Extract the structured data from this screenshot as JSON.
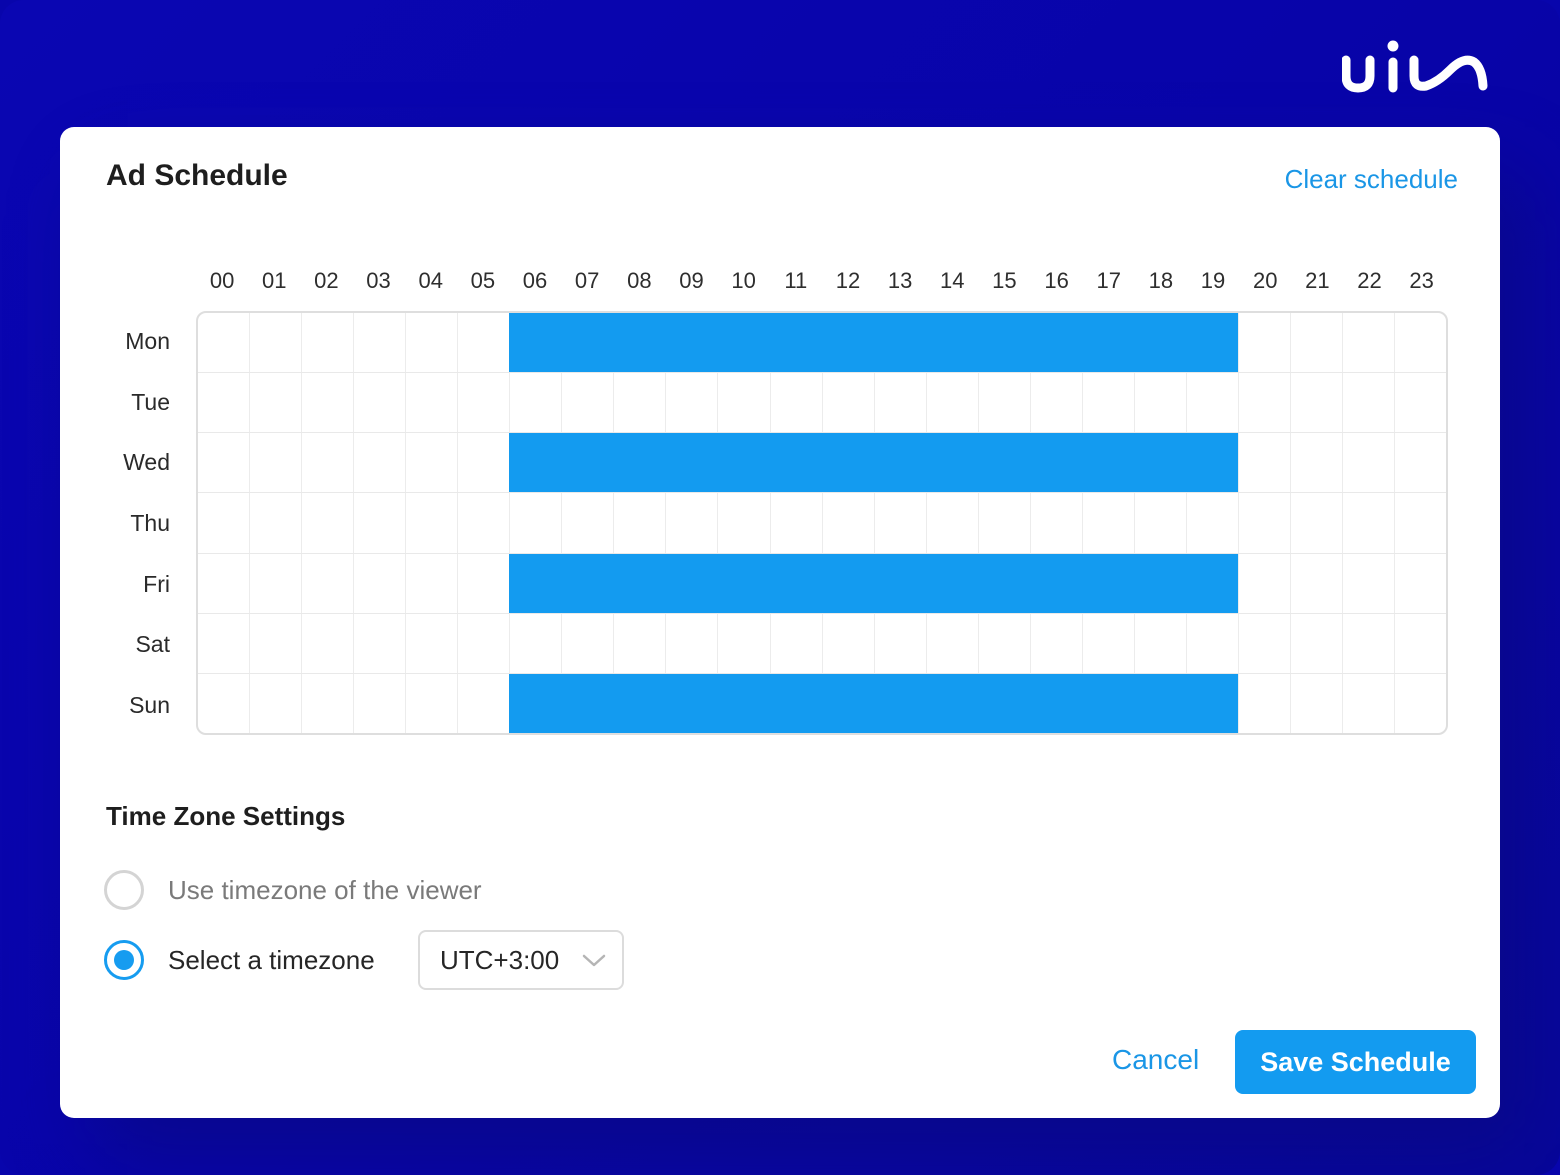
{
  "brand": {
    "logo_text": "uiu"
  },
  "dialog": {
    "title": "Ad Schedule",
    "clear_link": "Clear schedule"
  },
  "schedule": {
    "hours": [
      "00",
      "01",
      "02",
      "03",
      "04",
      "05",
      "06",
      "07",
      "08",
      "09",
      "10",
      "11",
      "12",
      "13",
      "14",
      "15",
      "16",
      "17",
      "18",
      "19",
      "20",
      "21",
      "22",
      "23"
    ],
    "days": [
      {
        "label": "Mon",
        "active_hours": [
          6,
          7,
          8,
          9,
          10,
          11,
          12,
          13,
          14,
          15,
          16,
          17,
          18,
          19
        ]
      },
      {
        "label": "Tue",
        "active_hours": []
      },
      {
        "label": "Wed",
        "active_hours": [
          6,
          7,
          8,
          9,
          10,
          11,
          12,
          13,
          14,
          15,
          16,
          17,
          18,
          19
        ]
      },
      {
        "label": "Thu",
        "active_hours": []
      },
      {
        "label": "Fri",
        "active_hours": [
          6,
          7,
          8,
          9,
          10,
          11,
          12,
          13,
          14,
          15,
          16,
          17,
          18,
          19
        ]
      },
      {
        "label": "Sat",
        "active_hours": []
      },
      {
        "label": "Sun",
        "active_hours": [
          6,
          7,
          8,
          9,
          10,
          11,
          12,
          13,
          14,
          15,
          16,
          17,
          18,
          19
        ]
      }
    ],
    "active_color": "#139bf0"
  },
  "timezone": {
    "section_title": "Time Zone Settings",
    "options": [
      {
        "label": "Use timezone of the viewer",
        "selected": false
      },
      {
        "label": "Select a timezone",
        "selected": true
      }
    ],
    "selected_value": "UTC+3:00",
    "dropdown_icon": "chevron-down-icon"
  },
  "footer": {
    "cancel_label": "Cancel",
    "save_label": "Save Schedule"
  },
  "colors": {
    "background": "#0805ac",
    "accent": "#139bf0",
    "link": "#1a96e6"
  }
}
